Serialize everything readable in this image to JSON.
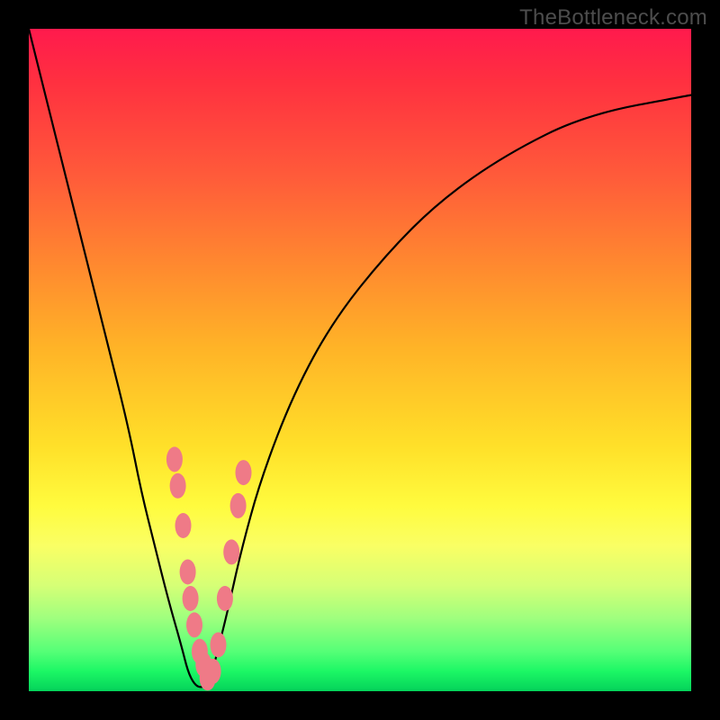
{
  "watermark": "TheBottleneck.com",
  "chart_data": {
    "type": "line",
    "title": "",
    "xlabel": "",
    "ylabel": "",
    "xlim": [
      0,
      100
    ],
    "ylim": [
      0,
      100
    ],
    "series": [
      {
        "name": "bottleneck-curve",
        "x": [
          0,
          3,
          6,
          9,
          12,
          15,
          17,
          19,
          21,
          23,
          24,
          25,
          26,
          27,
          28,
          30,
          32,
          35,
          40,
          46,
          54,
          62,
          72,
          84,
          100
        ],
        "values": [
          100,
          88,
          76,
          64,
          52,
          40,
          30,
          22,
          14,
          7,
          3,
          1,
          0.5,
          1,
          4,
          12,
          21,
          32,
          45,
          56,
          66,
          74,
          81,
          87,
          90
        ]
      }
    ],
    "annotations": {
      "markers_pink": {
        "description": "pink blob markers along lower part of curve",
        "x": [
          22.0,
          22.5,
          23.3,
          24.0,
          24.4,
          25.0,
          25.8,
          26.4,
          27.0,
          27.8,
          28.6,
          29.6,
          30.6,
          31.6,
          32.4
        ],
        "values": [
          35,
          31,
          25,
          18,
          14,
          10,
          6,
          4,
          2,
          3,
          7,
          14,
          21,
          28,
          33
        ]
      }
    },
    "colors": {
      "curve": "#000000",
      "markers": "#ef7a87",
      "gradient_top": "#ff1a4d",
      "gradient_bottom": "#04d25a"
    }
  }
}
